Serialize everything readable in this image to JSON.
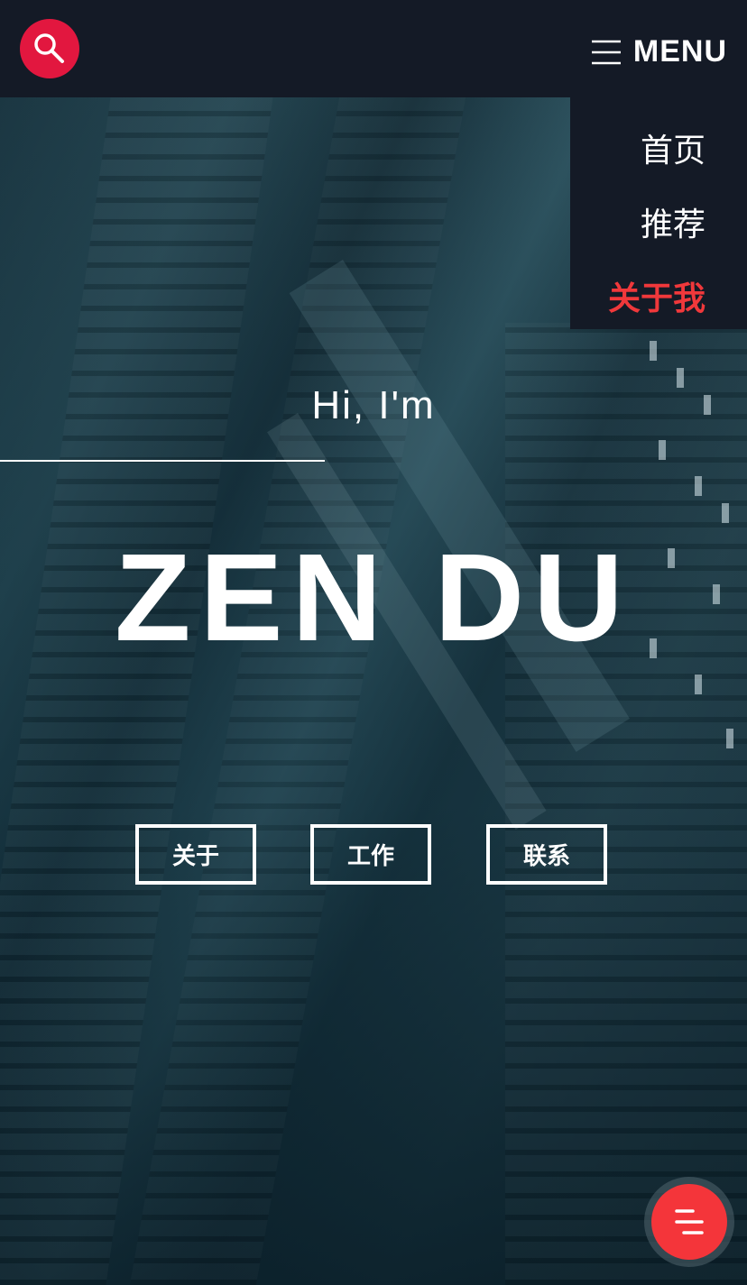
{
  "header": {
    "menu_label": "MENU"
  },
  "nav": {
    "items": [
      {
        "label": "首页",
        "active": false
      },
      {
        "label": "推荐",
        "active": false
      },
      {
        "label": "关于我",
        "active": true
      }
    ]
  },
  "hero": {
    "greeting": "Hi, I'm",
    "name": "ZEN DU",
    "buttons": [
      {
        "label": "关于"
      },
      {
        "label": "工作"
      },
      {
        "label": "联系"
      }
    ]
  },
  "colors": {
    "accent": "#e2173f",
    "active_nav": "#f0383b",
    "fab": "#f4353a",
    "header_bg": "#141a26"
  },
  "icons": {
    "search": "search-icon",
    "menu": "hamburger-icon",
    "fab": "menu-lines-icon"
  }
}
